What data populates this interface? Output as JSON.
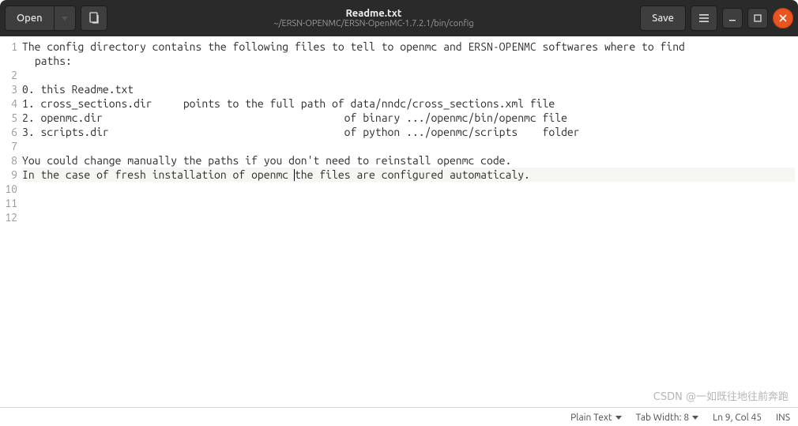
{
  "header": {
    "open_label": "Open",
    "save_label": "Save",
    "title": "Readme.txt",
    "subtitle": "~/ERSN-OPENMC/ERSN-OpenMC-1.7.2.1/bin/config"
  },
  "content": {
    "lines": [
      "The config directory contains the following files to tell to openmc and ERSN-OPENMC softwares where to find paths:",
      "",
      "0. this Readme.txt",
      "1. cross_sections.dir     points to the full path of data/nndc/cross_sections.xml file",
      "2. openmc.dir                                       of binary .../openmc/bin/openmc file",
      "3. scripts.dir                                      of python .../openmc/scripts    folder",
      "",
      "You could change manually the paths if you don't need to reinstall openmc code.",
      "In the case of fresh installation of openmc the files are configured automaticaly.",
      "",
      "",
      ""
    ],
    "wrapped_line1_rest": " paths:",
    "cursor_line_index": 8,
    "cursor_col": 45
  },
  "line_numbers": [
    "1",
    "2",
    "3",
    "4",
    "5",
    "6",
    "7",
    "8",
    "9",
    "10",
    "11",
    "12"
  ],
  "statusbar": {
    "language": "Plain Text",
    "tab_width_label": "Tab Width: 8",
    "position": "Ln 9, Col 45",
    "insert_mode": "INS"
  },
  "watermark": "CSDN @一如既往地往前奔跑"
}
